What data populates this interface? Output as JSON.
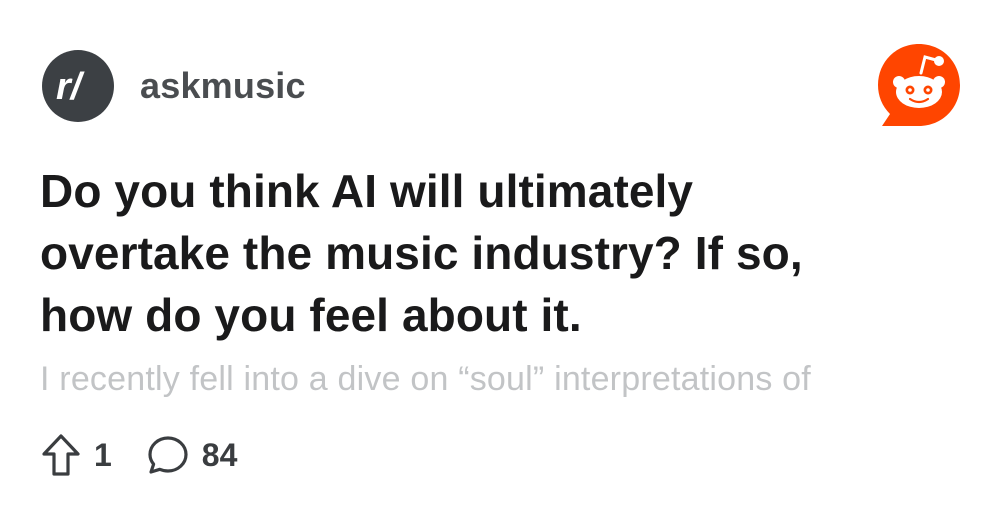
{
  "post": {
    "subreddit": "askmusic",
    "subreddit_icon_text": "r/",
    "title_lines": [
      "Do you think AI will ultimately",
      "overtake the music industry? If so,",
      "how do you feel about it."
    ],
    "body_preview": "I recently fell into a dive on “soul” interpretations of",
    "upvotes": "1",
    "comments": "84"
  },
  "icons": {
    "upvote": "upvote-arrow-icon",
    "comment": "comment-bubble-icon",
    "brand": "reddit-snoo-icon"
  },
  "colors": {
    "avatar_bg": "#3c4044",
    "brand_orange": "#ff4500",
    "preview_text": "#c2c4c6"
  }
}
